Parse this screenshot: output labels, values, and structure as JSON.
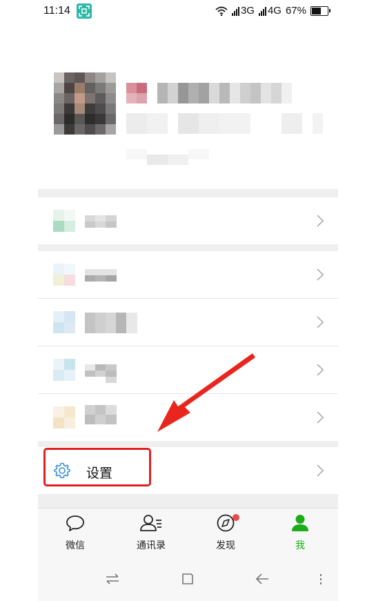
{
  "status_bar": {
    "time": "11:14",
    "network1": "3G",
    "network2": "4G",
    "battery_percent": "67%",
    "battery_level": 0.67
  },
  "menu": {
    "settings_label": "设置"
  },
  "tabbar": {
    "tabs": [
      {
        "label": "微信",
        "icon": "chat-bubble-icon",
        "active": false
      },
      {
        "label": "通讯录",
        "icon": "contacts-icon",
        "active": false
      },
      {
        "label": "发现",
        "icon": "compass-icon",
        "active": false
      },
      {
        "label": "我",
        "icon": "person-icon",
        "active": true
      }
    ],
    "discover_badge": true
  },
  "colors": {
    "accent": "#1aad19",
    "highlight": "#e02020",
    "badge": "#f04848",
    "screenshot_icon_bg": "#2bb9a8"
  }
}
